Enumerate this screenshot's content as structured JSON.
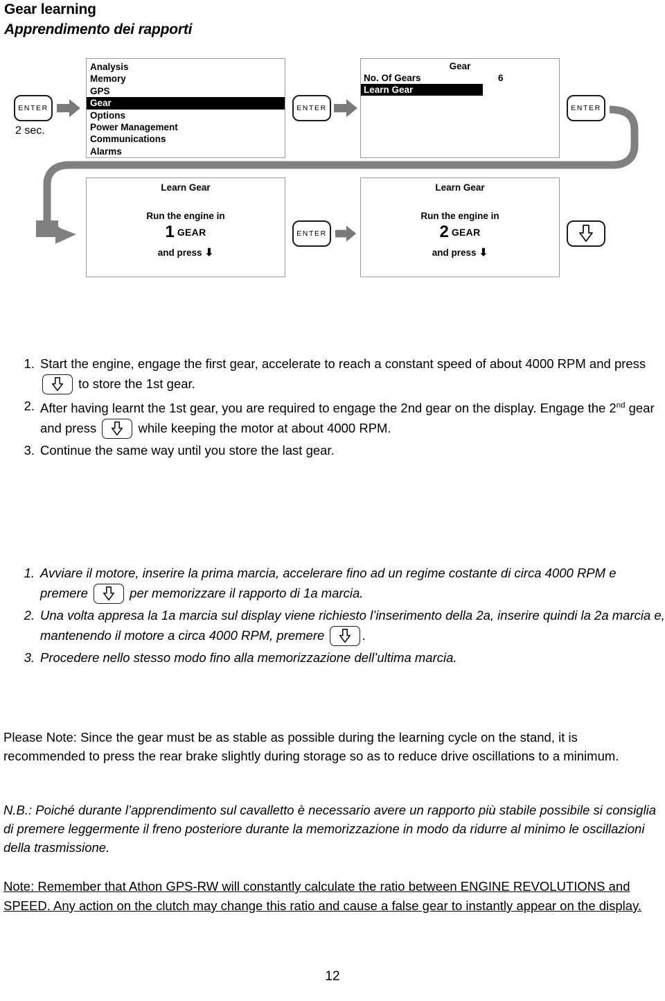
{
  "headings": {
    "title_en": "Gear learning",
    "title_it": "Apprendimento dei rapporti"
  },
  "diagram": {
    "press_duration_label": "2 sec.",
    "enter_key_label": "ENTER",
    "menu_screen": {
      "items": [
        "Analysis",
        "Memory",
        "GPS",
        "Gear",
        "Options",
        "Power Management",
        "Communications",
        "Alarms"
      ],
      "selected_index": 3
    },
    "gear_screen": {
      "title": "Gear",
      "rows": [
        {
          "label": "No. Of Gears",
          "value": "6",
          "selected": false
        },
        {
          "label": "Learn Gear",
          "value": "",
          "selected": true
        }
      ]
    },
    "learn_gear_screen_1": {
      "title": "Learn Gear",
      "line1": "Run the engine in",
      "gear_number": "1",
      "gear_unit": "GEAR",
      "line3": "and press"
    },
    "learn_gear_screen_2": {
      "title": "Learn Gear",
      "line1": "Run the engine in",
      "gear_number": "2",
      "gear_unit": "GEAR",
      "line3": "and press"
    }
  },
  "instructions_en": {
    "step1_num": "1.",
    "step1_part_a": "Start the engine, engage the first gear, accelerate to reach a constant speed of about 4000 RPM and press",
    "step1_part_b": "to store the 1st gear.",
    "step2_num": "2.",
    "step2_part_a": "After having learnt the 1st gear, you are required to engage the 2nd gear on the display. Engage the 2",
    "step2_sup": "nd",
    "step2_part_b": "gear and press",
    "step2_part_c": "while keeping the motor at about 4000 RPM.",
    "step3_num": "3.",
    "step3_text": "Continue the same way until you store the last gear."
  },
  "instructions_it": {
    "step1_num": "1.",
    "step1_part_a": "Avviare il motore, inserire la prima marcia, accelerare fino ad un regime costante di circa 4000 RPM e premere",
    "step1_part_b": "per memorizzare il rapporto di 1a marcia.",
    "step2_num": "2.",
    "step2_part_a": "Una volta appresa la 1a marcia sul display viene richiesto l’inserimento della 2a, inserire quindi la 2a marcia e, mantenendo il motore a circa 4000 RPM, premere",
    "step2_part_b": ".",
    "step3_num": "3.",
    "step3_text": "Procedere nello stesso modo fino alla memorizzazione dell’ultima marcia."
  },
  "notes": {
    "note_en": "Please Note: Since the gear must be as stable as possible during the learning cycle on the stand, it is recommended to press the rear brake slightly during storage so as to reduce drive oscillations to a minimum.",
    "note_it": "N.B.: Poiché durante l’apprendimento sul cavalletto è necessario avere un rapporto più stabile possibile si consiglia di premere leggermente il freno posteriore durante la memorizzazione in modo da ridurre al minimo le oscillazioni della trasmissione.",
    "note_final": "Note: Remember that Athon GPS-RW will constantly calculate the ratio between ENGINE REVOLUTIONS and SPEED. Any action on the clutch may change this ratio and cause a false gear to instantly appear on the display."
  },
  "footer": {
    "page_number": "12"
  },
  "colors": {
    "connector_gray": "#808080",
    "arrow_gray": "#7a7a7a",
    "screen_border": "#9a9a9a",
    "highlight_bg": "#000000",
    "text": "#000000"
  }
}
